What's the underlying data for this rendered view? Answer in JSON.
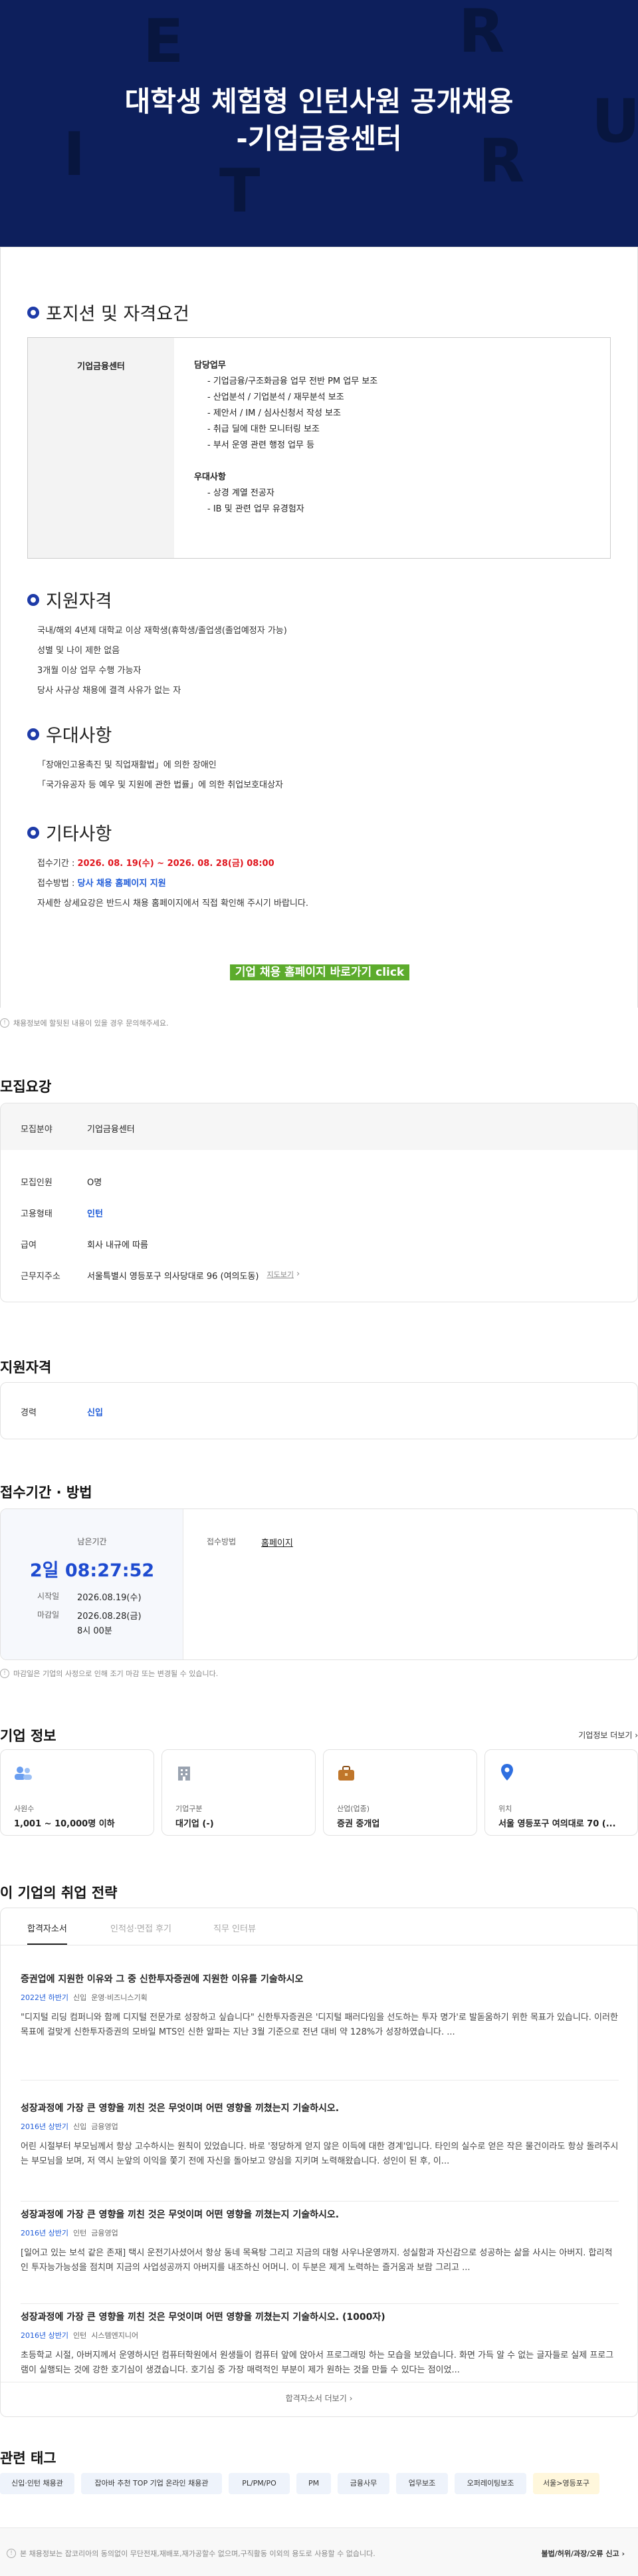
{
  "hero": {
    "title_line1": "대학생 체험형 인턴사원 공개채용",
    "title_line2": "-기업금융센터",
    "bg_letters": [
      "E",
      "R",
      "I",
      "U",
      "T",
      "R"
    ]
  },
  "position": {
    "heading": "포지션 및 자격요건",
    "dept": "기업금융센터",
    "duty_title": "담당업무",
    "duties": [
      "기업금융/구조화금융 업무 전반 PM 업무 보조",
      "산업분석 / 기업분석 / 재무분석 보조",
      "제안서 / IM / 심사신청서 작성 보조",
      "취급 딜에 대한 모니터링 보조",
      "부서 운영 관련 행정 업무 등"
    ],
    "pref_title": "우대사항",
    "prefs": [
      "상경 계열 전공자",
      "IB 및 관련 업무 유경험자"
    ]
  },
  "qual": {
    "heading": "지원자격",
    "items": [
      "국내/해외 4년제 대학교 이상 재학생(휴학생/졸업생(졸업예정자 가능)",
      "성별 및 나이 제한 없음",
      "3개월 이상 업무 수행 가능자",
      "당사 사규상 채용에 결격 사유가 없는 자"
    ]
  },
  "pref": {
    "heading": "우대사항",
    "items": [
      "「장애인고용촉진 및 직업재활법」에 의한 장애인",
      "「국가유공자 등 예우 및 지원에 관한 법률」에 의한 취업보호대상자"
    ]
  },
  "etc": {
    "heading": "기타사항",
    "period_label": "접수기간 : ",
    "period_value": "2026. 08. 19(수) ~ 2026. 08. 28(금) 08:00",
    "method_label": "접수방법 : ",
    "method_value": "당사 채용 홈페이지 지원",
    "detail": "자세한 상세요강은 반드시 채용 홈페이지에서 직접 확인해 주시기 바랍니다."
  },
  "cta": "기업 채용 홈페이지 바로가기 click",
  "notice1": "채용정보에 할뒷된 내용이 있을 경우 문의해주세요.",
  "summary": {
    "heading": "모집요강",
    "field_label": "모집분야",
    "field_value": "기업금융센터",
    "rows": [
      {
        "k": "모집인원",
        "v": "O명"
      },
      {
        "k": "고용형태",
        "v": "인턴"
      },
      {
        "k": "급여",
        "v": "회사 내규에 따름"
      },
      {
        "k": "근무지주소",
        "v": "서울특별시 영등포구 의사당대로 96 (여의도동)"
      }
    ],
    "map_link": "지도보기"
  },
  "qualification": {
    "heading": "지원자격",
    "k": "경력",
    "v": "신입"
  },
  "apply": {
    "heading": "접수기간 · 방법",
    "remain_label": "남은기간",
    "remain_value": "2일 08:27:52",
    "start_label": "시작일",
    "start_value": "2026.08.19(수)",
    "end_label": "마감일",
    "end_value": "2026.08.28(금)",
    "end_time": "8시 00분",
    "method_label": "접수방법",
    "method_value": "홈페이지",
    "note": "마감일은 기업의 사정으로 인해 조기 마감 또는 변경될 수 있습니다."
  },
  "company": {
    "heading": "기업 정보",
    "more": "기업정보 더보기",
    "cards": [
      {
        "label": "사원수",
        "value": "1,001 ~ 10,000명 이하",
        "icon": "people-icon",
        "color": "#6a9ef0"
      },
      {
        "label": "기업구분",
        "value": "대기업 (-)",
        "icon": "building-icon",
        "color": "#9aa3b0"
      },
      {
        "label": "산업(업종)",
        "value": "증권 중개업",
        "icon": "briefcase-icon",
        "color": "#c0762a"
      },
      {
        "label": "위치",
        "value": "서울 영등포구 여의대로 70 (...",
        "icon": "pin-icon",
        "color": "#2f6fe0"
      }
    ]
  },
  "strategy": {
    "heading": "이 기업의 취업 전략",
    "tabs": [
      "합격자소서",
      "인적성·면접 후기",
      "직무 인터뷰"
    ],
    "items": [
      {
        "q": "증권업에 지원한 이유와 그 중 신한투자증권에 지원한 이유를 기술하시오",
        "meta": [
          "2022년 하반기",
          "신입",
          "운영·비즈니스기획"
        ],
        "a": "\"디지털 리딩 컴퍼니와 함께 디지털 전문가로 성장하고 싶습니다\" 신한투자증권은 '디지털 패러다임을 선도하는 투자 명가'로 발돋움하기 위한 목표가 있습니다. 이러한 목표에 걸맞게 신한투자증권의 모바일 MTS인 신한 알파는 지난 3월 기준으로 전년 대비 약 128%가 성장하였습니다. ..."
      },
      {
        "q": "성장과정에 가장 큰 영향을 끼친 것은 무엇이며 어떤 영향을 끼쳤는지 기술하시오.",
        "meta": [
          "2016년 상반기",
          "신입",
          "금융영업"
        ],
        "a": "어린 시절부터 부모님께서 항상 고수하시는 원칙이 있었습니다. 바로 '정당하게 얻지 않은 이득에 대한 경계'입니다. 타인의 실수로 얻은 작은 물건이라도 항상 돌려주시는 부모님을 보며, 저 역시 눈앞의 이익을 쫓기 전에 자신을 돌아보고 양심을 지키며 노력해왔습니다. 성인이 된 후, 이..."
      },
      {
        "q": "성장과정에 가장 큰 영향을 끼친 것은 무엇이며 어떤 영향을 끼쳤는지 기술하시오.",
        "meta": [
          "2016년 상반기",
          "인턴",
          "금융영업"
        ],
        "a": "[일어고 있는 보석 같은 존재] 택시 운전기사셨어서 항상 동네 목욕탕 그리고 지금의 대형 사우나운영까지. 성실함과 자신감으로 성공하는 삶을 사시는 아버지. 합리적인 투자능가능성을 점치며 지금의 사업성공까지 아버지를 내조하신 어머니. 이 두분은 제게 노력하는 즐거움과 보람 그리고 ..."
      },
      {
        "q": "성장과정에 가장 큰 영향을 끼친 것은 무엇이며 어떤 영향을 끼쳤는지 기술하시오. (1000자)",
        "meta": [
          "2016년 상반기",
          "인턴",
          "시스템엔지니어"
        ],
        "a": "초등학교 시절, 아버지께서 운영하시던 컴퓨터학원에서 원생들이 컴퓨터 앞에 앉아서 프로그래밍 하는 모습을 보았습니다. 화면 가득 알 수 없는 글자들로 실제 프로그램이 실행되는 것에 강한 호기심이 생겼습니다. 호기심 중 가장 매력적인 부분이 제가 원하는 것을 만들 수 있다는 점이었..."
      }
    ],
    "more": "합격자소서 더보기"
  },
  "tags": {
    "heading": "관련 태그",
    "items": [
      "신입·인턴 채용관",
      "잡아바 추천 TOP 기업 온라인 채용관",
      "PL/PM/PO",
      "PM",
      "금융사무",
      "업무보조",
      "오퍼레이팅보조",
      "서울>영등포구"
    ]
  },
  "footer": {
    "text": "본 채용정보는 잡코리아의 동의없이 무단전재,재배포,재가공할수 없으며,구직활동 이외의 용도로 사용할 수 없습니다.",
    "report": "불법/허위/과장/오류 신고"
  }
}
